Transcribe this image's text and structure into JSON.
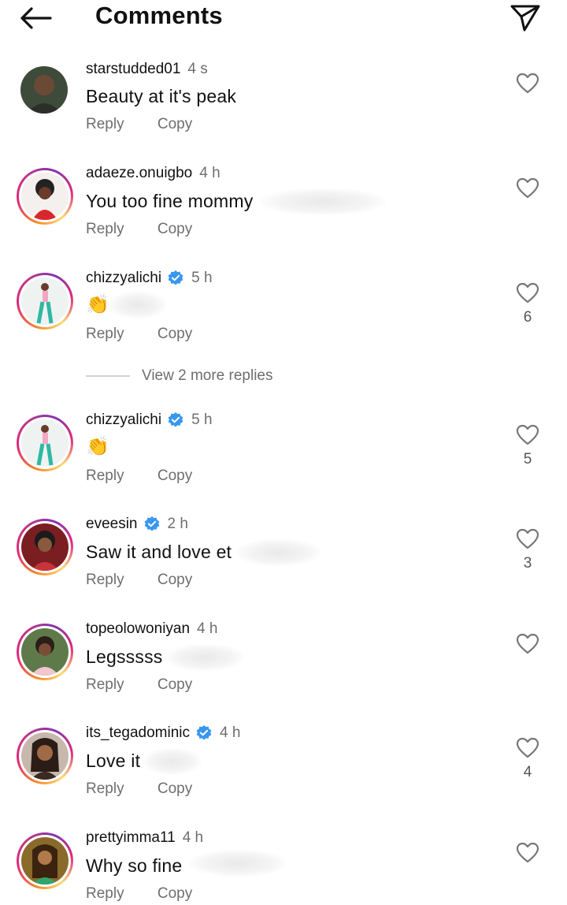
{
  "header": {
    "title": "Comments",
    "back_icon": "arrow-left-icon",
    "share_icon": "paper-plane-icon"
  },
  "actions": {
    "reply_label": "Reply",
    "copy_label": "Copy"
  },
  "view_more_replies": "View 2 more replies",
  "colors": {
    "verified": "#3897f0",
    "text": "#111111",
    "secondary": "#6e6e6e"
  },
  "comments": [
    {
      "username": "starstudded01",
      "time": "4 s",
      "text": "Beauty at it's peak",
      "verified": false,
      "likes": ""
    },
    {
      "username": "adaeze.onuigbo",
      "time": "4 h",
      "text": "You too fine mommy",
      "verified": false,
      "likes": ""
    },
    {
      "username": "chizzyalichi",
      "time": "5 h",
      "text": "👏",
      "verified": true,
      "likes": "6"
    },
    {
      "username": "chizzyalichi",
      "time": "5 h",
      "text": "👏",
      "verified": true,
      "likes": "5"
    },
    {
      "username": "eveesin",
      "time": "2 h",
      "text": "Saw it and love et",
      "verified": true,
      "likes": "3"
    },
    {
      "username": "topeolowoniyan",
      "time": "4 h",
      "text": "Legsssss",
      "verified": false,
      "likes": ""
    },
    {
      "username": "its_tegadominic",
      "time": "4 h",
      "text": "Love it",
      "verified": true,
      "likes": "4"
    },
    {
      "username": "prettyimma11",
      "time": "4 h",
      "text": "Why so fine",
      "verified": false,
      "likes": ""
    }
  ]
}
